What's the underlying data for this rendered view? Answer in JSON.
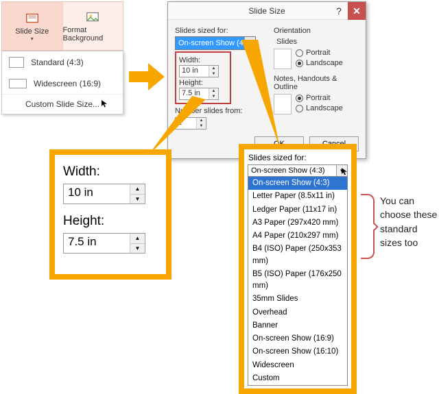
{
  "ribbon": {
    "slide_size_label": "Slide Size",
    "format_bg_label": "Format Background"
  },
  "sizemenu": {
    "standard": "Standard (4:3)",
    "widescreen": "Widescreen (16:9)",
    "custom": "Custom Slide Size..."
  },
  "dialog": {
    "title": "Slide Size",
    "slides_sized_for": "Slides sized for:",
    "selected_size": "On-screen Show (4:3)",
    "width_label": "Width:",
    "width_value": "10 in",
    "height_label": "Height:",
    "height_value": "7.5 in",
    "number_from_label": "Number slides from:",
    "number_from_value": "1",
    "orientation_label": "Orientation",
    "slides_label": "Slides",
    "notes_label": "Notes, Handouts & Outline",
    "portrait": "Portrait",
    "landscape": "Landscape",
    "ok": "OK",
    "cancel": "Cancel"
  },
  "zoom_wh": {
    "width_label": "Width:",
    "width_value": "10 in",
    "height_label": "Height:",
    "height_value": "7.5 in"
  },
  "zoom_list": {
    "header": "Slides sized for:",
    "selected": "On-screen Show (4:3)",
    "options": [
      "On-screen Show (4:3)",
      "Letter Paper (8.5x11 in)",
      "Ledger Paper (11x17 in)",
      "A3 Paper (297x420 mm)",
      "A4 Paper (210x297 mm)",
      "B4 (ISO) Paper (250x353 mm)",
      "B5 (ISO) Paper (176x250 mm)",
      "35mm Slides",
      "Overhead",
      "Banner",
      "On-screen Show (16:9)",
      "On-screen Show (16:10)",
      "Widescreen",
      "Custom"
    ]
  },
  "side_text": "You can choose these standard sizes too",
  "colors": {
    "accent": "#f7a600",
    "highlight_box": "#c23e3e",
    "select_blue": "#3399ff"
  }
}
